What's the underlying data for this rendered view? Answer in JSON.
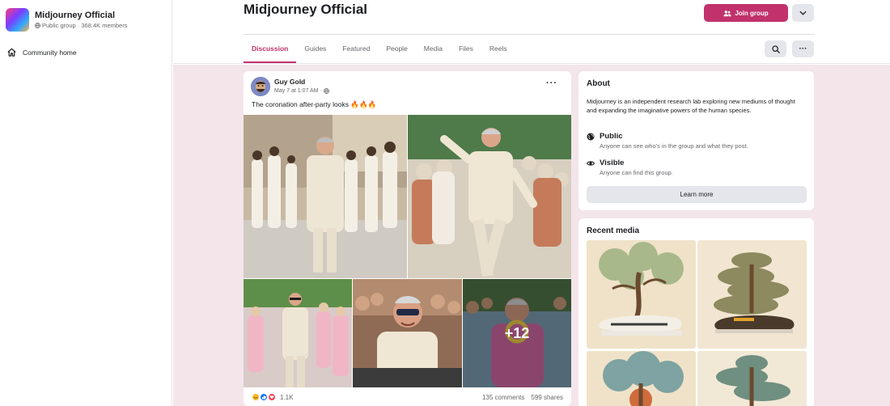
{
  "sidebar": {
    "group_name": "Midjourney Official",
    "group_sub": "Public group · 368.4K members",
    "community_home": "Community home"
  },
  "header": {
    "title": "Midjourney Official",
    "join_label": "Join group",
    "tabs": [
      "Discussion",
      "Guides",
      "Featured",
      "People",
      "Media",
      "Files",
      "Reels"
    ],
    "active_tab": "Discussion"
  },
  "post": {
    "author": "Guy Gold",
    "time": "May 7 at 1:07 AM ·",
    "text": "The coronation after-party looks",
    "emoji": "🔥🔥🔥",
    "more_photos": "+12",
    "reaction_count": "1.1K",
    "comments": "135 comments",
    "shares": "599 shares"
  },
  "about": {
    "title": "About",
    "description": "Midjourney is an independent research lab exploring new mediums of thought and expanding the imaginative powers of the human species.",
    "public_title": "Public",
    "public_sub": "Anyone can see who's in the group and what they post.",
    "visible_title": "Visible",
    "visible_sub": "Anyone can find this group.",
    "learn_more": "Learn more"
  },
  "recent_media": {
    "title": "Recent media"
  },
  "colors": {
    "accent": "#c1326c",
    "feed_bg": "#f3e5ea",
    "button_gray": "#e4e6eb"
  }
}
